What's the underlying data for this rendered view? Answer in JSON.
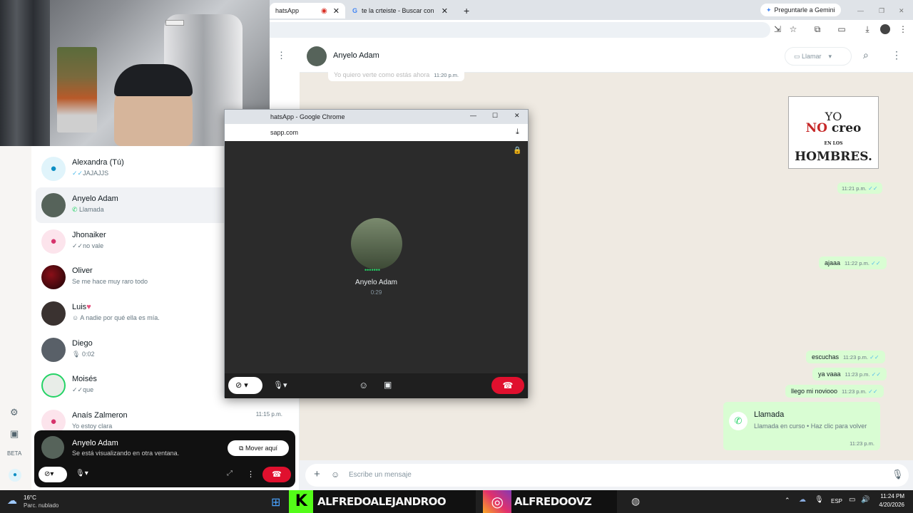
{
  "browser": {
    "tabs": [
      {
        "label": "hatsApp"
      },
      {
        "label": "te la crteiste - Buscar con Goog"
      }
    ],
    "gemini_button": "Preguntarle a Gemini"
  },
  "call_popup": {
    "window_title": "hatsApp - Google Chrome",
    "url": "sapp.com",
    "contact_name": "Anyelo Adam",
    "duration": "0:29"
  },
  "conversation": {
    "contact_name": "Anyelo Adam",
    "call_label": "Llamar",
    "partial_message": {
      "text": "Yo quiero verte como estás ahora",
      "time": "11:20 p.m."
    },
    "sticker_text": {
      "line1": "YO",
      "line2": "NO",
      "line3": "creo",
      "line4": "EN LOS",
      "line5": "HOMBRES."
    },
    "sticker_time": "11:21 p.m.",
    "messages": [
      {
        "text": "ajaaa",
        "time": "11:22 p.m."
      },
      {
        "text": "escuchas",
        "time": "11:23 p.m."
      },
      {
        "text": "ya vaaa",
        "time": "11:23 p.m."
      },
      {
        "text": "llego mi noviooo",
        "time": "11:23 p.m."
      }
    ],
    "call_card": {
      "title": "Llamada",
      "subtitle": "Llamada en curso • Haz clic para volver",
      "time": "11:23 p.m."
    },
    "composer_placeholder": "Escribe un mensaje"
  },
  "chats": [
    {
      "name": "Alexandra (Tú)",
      "preview": "JAJAJJS",
      "time": ""
    },
    {
      "name": "Anyelo Adam",
      "preview": "Llamada",
      "time": ""
    },
    {
      "name": "Jhonaiker",
      "preview": "no vale",
      "time": ""
    },
    {
      "name": "Oliver",
      "preview": "Se me hace muy raro todo",
      "time": ""
    },
    {
      "name": "Luis",
      "preview": "A nadie por qué ella es mía.",
      "time": ""
    },
    {
      "name": "Diego",
      "preview": "0:02",
      "time": ""
    },
    {
      "name": "Moisés",
      "preview": "que",
      "time": ""
    },
    {
      "name": "Anaís Zalmeron",
      "preview": "Yo estoy clara",
      "time": "11:15 p.m."
    }
  ],
  "rail": {
    "beta_label": "BETA"
  },
  "mini_call": {
    "name": "Anyelo Adam",
    "status": "Se está visualizando en otra ventana.",
    "move_button": "Mover aquí"
  },
  "taskbar": {
    "weather_temp": "16°C",
    "weather_desc": "Parc. nublado",
    "banner_left": "ALFREDOALEJANDROO",
    "banner_right": "ALFREDOOVZ",
    "lang": "ESP",
    "time": "11:24 PM",
    "date": "4/20/2026"
  },
  "colors": {
    "accent_green": "#25d366",
    "end_call_red": "#e0102e",
    "outgoing_bubble": "#d9fdd3",
    "chat_bg": "#efeae2"
  }
}
